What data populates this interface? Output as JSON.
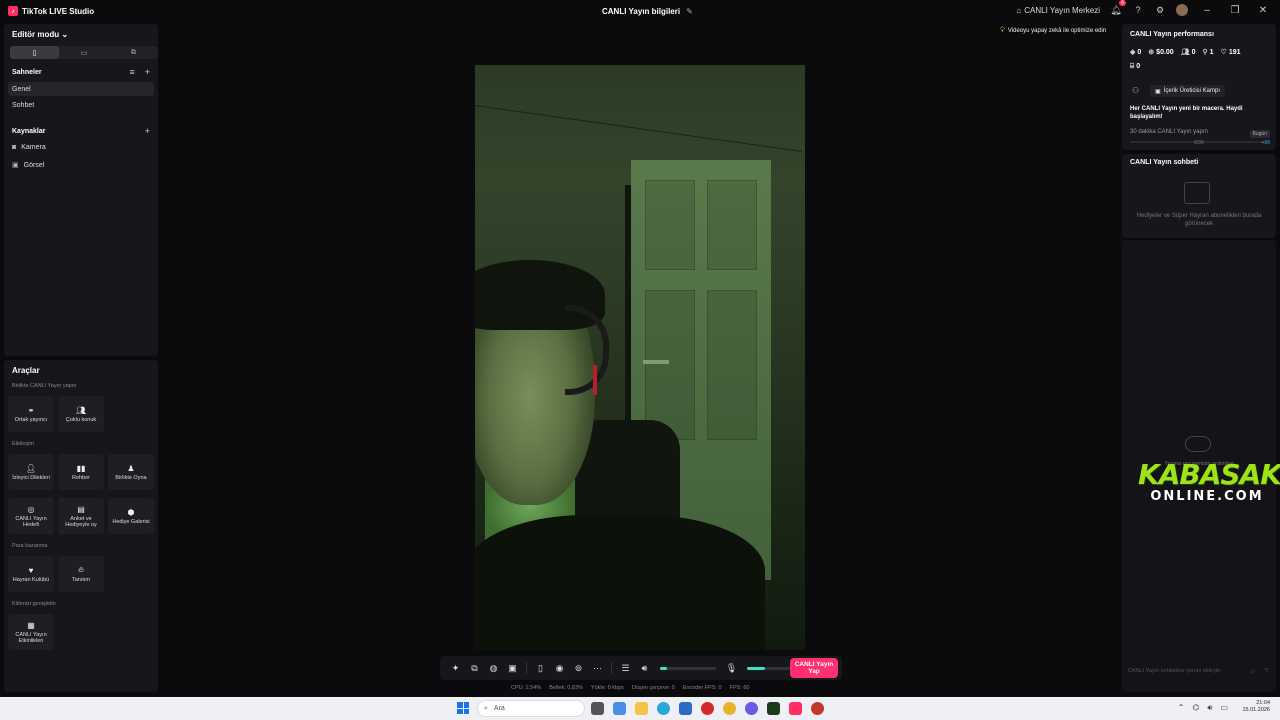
{
  "app": {
    "title": "TikTok LIVE Studio",
    "stream_info": "CANLI Yayın bilgileri",
    "live_center": "CANLI Yayın Merkezi",
    "notification_count": "6"
  },
  "left": {
    "editor_mode": "Editör modu",
    "scenes_title": "Sahneler",
    "scenes": [
      "Genel",
      "Sohbet"
    ],
    "sources_title": "Kaynaklar",
    "sources": [
      "Kamera",
      "Görsel"
    ],
    "tools_title": "Araçlar",
    "groups": {
      "together": "Birlikte CANLI Yayın yapın",
      "engagement": "Etkileşim",
      "monetize": "Para kazanma",
      "expand": "Kitlenizi genişletin"
    },
    "tools": {
      "cohost": "Ortak yayıncı",
      "multiguest": "Çoklu konuk",
      "viewer_wishes": "İzleyici Dilekleri",
      "guide": "Rehber",
      "play_together": "Birlikte Oyna",
      "live_goal": "CANLI Yayın Hedefi",
      "poll": "Anket ve Hediyeyle oy",
      "gift_gallery": "Hediye Galerisi",
      "fan_club": "Hayran Kulübü",
      "promote": "Tanıtım",
      "live_events": "CANLI Yayın Etkinlikleri"
    }
  },
  "center": {
    "optimize": "Videoyu yapay zekâ ile optimize edin",
    "go_live": "CANLI Yayın Yap",
    "status": {
      "cpu": "CPU:  2,54%",
      "memory": "Bellek:  0,83%",
      "upload": "Yükle:  0 kbps",
      "dropped": "Düşen çerçeve:  0",
      "encoder": "Encoder FPS:  0",
      "fps": "FPS:  60"
    },
    "mic_level": 0.32,
    "volume_level": 0.12
  },
  "right": {
    "performance_title": "CANLI Yayın performansı",
    "stats": {
      "gems": "0",
      "money": "$0.00",
      "viewers": "0",
      "followers": "1",
      "likes": "191",
      "gifts": "0"
    },
    "campaign": "İçerik Üreticisi Kampı",
    "promo": "Her CANLI Yayın yeni bir macera. Haydi başlayalım!",
    "task": "30 dakika CANLI Yayın yapın",
    "today": "Bugün",
    "task_progress": "0/30",
    "task_progress_value": 0,
    "reward": "+20",
    "chat_title": "CANLI Yayın sohbeti",
    "chat_empty": "Hediyeler ve Süper Hayran abonelikleri burada görünecek",
    "after_live": "Yayına geçmenizin ardından",
    "chat_input": "CANLI Yayın sohbetine yorum ekleyin"
  },
  "watermark": {
    "top": "KABASAKAL",
    "bottom": "ONLINE.COM"
  },
  "taskbar": {
    "search_placeholder": "Ara",
    "time": "21:04",
    "date": "15.01.2026"
  },
  "colors": {
    "accent": "#ff2f72",
    "meter": "#3de3c1",
    "logo_green": "#9ee31a"
  }
}
